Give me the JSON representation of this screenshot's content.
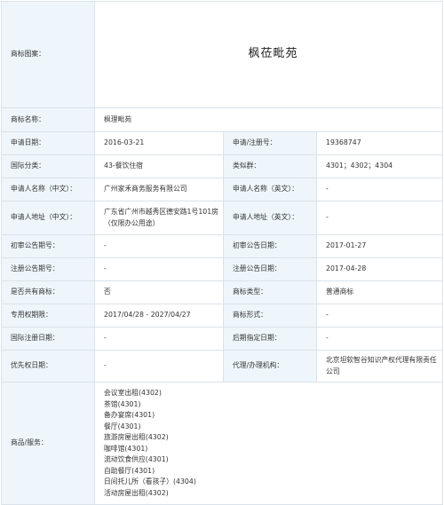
{
  "trademark": {
    "image_label": "商标图案：",
    "image_text": "枫莅毗苑",
    "name_label": "商标名称：",
    "name_value": "枫理毗苑",
    "apply_date_label": "申请日期：",
    "apply_date_value": "2016-03-21",
    "reg_no_label": "申请/注册号：",
    "reg_no_value": "19368747",
    "class_label": "国际分类：",
    "class_value": "43-餐饮住宿",
    "group_label": "类似群：",
    "group_value": "4301；4302；4304",
    "applicant_cn_label": "申请人名称（中文）：",
    "applicant_cn_value": "广州家禾商务服务有限公司",
    "applicant_en_label": "申请人名称（英文）：",
    "applicant_en_value": "-",
    "address_cn_label": "申请人地址（中文）：",
    "address_cn_value": "广东省广州市越秀区德安路1号101房（仅限办公用途）",
    "address_en_label": "申请人地址（英文）：",
    "address_en_value": "-",
    "prelim_no_label": "初审公告期号：",
    "prelim_no_value": "-",
    "prelim_date_label": "初审公告日期：",
    "prelim_date_value": "2017-01-27",
    "reg_ann_no_label": "注册公告期号：",
    "reg_ann_no_value": "-",
    "reg_ann_date_label": "注册公告日期：",
    "reg_ann_date_value": "2017-04-28",
    "shared_label": "是否共有商标：",
    "shared_value": "否",
    "type_label": "商标类型：",
    "type_value": "普通商标",
    "exclusive_label": "专用权期限：",
    "exclusive_value": "2017/04/28 - 2027/04/27",
    "form_label": "商标形式：",
    "form_value": "-",
    "intl_reg_label": "国际注册日期：",
    "intl_reg_value": "-",
    "later_date_label": "后期指定日期：",
    "later_date_value": "-",
    "priority_label": "优先权日期：",
    "priority_value": "-",
    "agent_label": "代理/办理机构：",
    "agent_value": "北京坦软智谷知识产权代理有限责任公司",
    "services_label": "商品/服务：",
    "services": [
      "会议室出租(4302)",
      "茶馆(4301)",
      "备办宴席(4301)",
      "餐厅(4301)",
      "旅游房屋出租(4302)",
      "咖啡馆(4301)",
      "流动饮食供应(4301)",
      "自助餐厅(4301)",
      "日间托儿所（看孩子）(4304)",
      "活动房屋出租(4302)"
    ]
  }
}
